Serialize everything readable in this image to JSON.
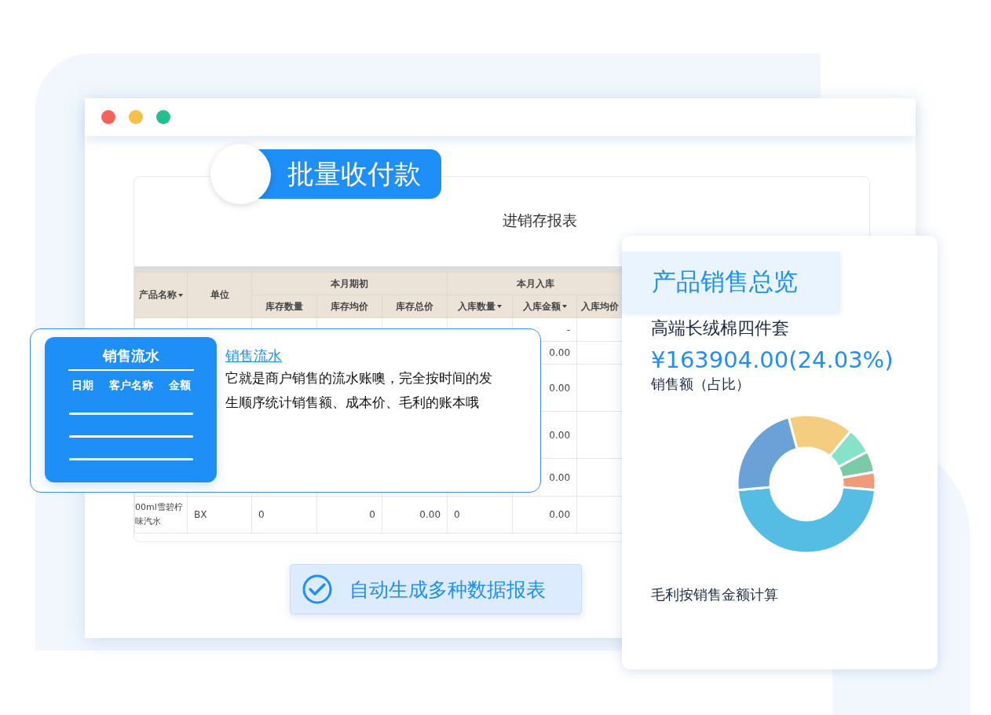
{
  "window": {
    "dots": [
      {
        "color": "#f5625a"
      },
      {
        "color": "#f7bf4b"
      },
      {
        "color": "#20c18f"
      }
    ]
  },
  "badge": {
    "label": "批量收付款"
  },
  "report": {
    "title": "进销存报表",
    "header": [
      {
        "label": "产品名称",
        "sortable": true
      },
      {
        "label": "单位",
        "sortable": false
      },
      {
        "label": "本月期初",
        "children": [
          {
            "label": "库存数量",
            "sortable": false
          },
          {
            "label": "库存均价",
            "sortable": false
          },
          {
            "label": "库存总价",
            "sortable": false
          }
        ]
      },
      {
        "label": "本月入库",
        "children": [
          {
            "label": "入库数量",
            "sortable": true
          },
          {
            "label": "入库金额",
            "sortable": true
          },
          {
            "label": "入库均价",
            "sortable": false
          }
        ]
      }
    ],
    "rows": [
      {
        "cells": [
          null,
          null,
          null,
          null,
          null,
          null,
          "-",
          null
        ]
      },
      {
        "cells": [
          null,
          null,
          null,
          null,
          null,
          null,
          "0.00",
          null
        ]
      },
      {
        "cells": [
          null,
          null,
          null,
          null,
          null,
          null,
          "0.00",
          null
        ]
      },
      {
        "cells": [
          null,
          null,
          null,
          null,
          null,
          null,
          "0.00",
          null
        ]
      },
      {
        "cells": [
          null,
          null,
          null,
          null,
          null,
          null,
          "0.00",
          null
        ]
      },
      {
        "cells": [
          "00ml雪碧柠味汽水",
          "BX",
          "0",
          "0",
          "0.00",
          "0",
          "0.00",
          null
        ]
      }
    ]
  },
  "popup": {
    "card": {
      "title": "销售流水",
      "columns": [
        "日期",
        "客户名称",
        "金额"
      ]
    },
    "link": "销售流水",
    "text": "它就是商户销售的流水账噢，完全按时间的发生顺序统计销售额、成本价、毛利的账本哦"
  },
  "auto_badge": {
    "label": "自动生成多种数据报表"
  },
  "overview": {
    "title": "产品销售总览",
    "product": "高端长绒棉四件套",
    "amount": "¥163904.00(24.03%)",
    "amount_label": "销售额（占比）",
    "note": "毛利按销售金额计算"
  }
}
